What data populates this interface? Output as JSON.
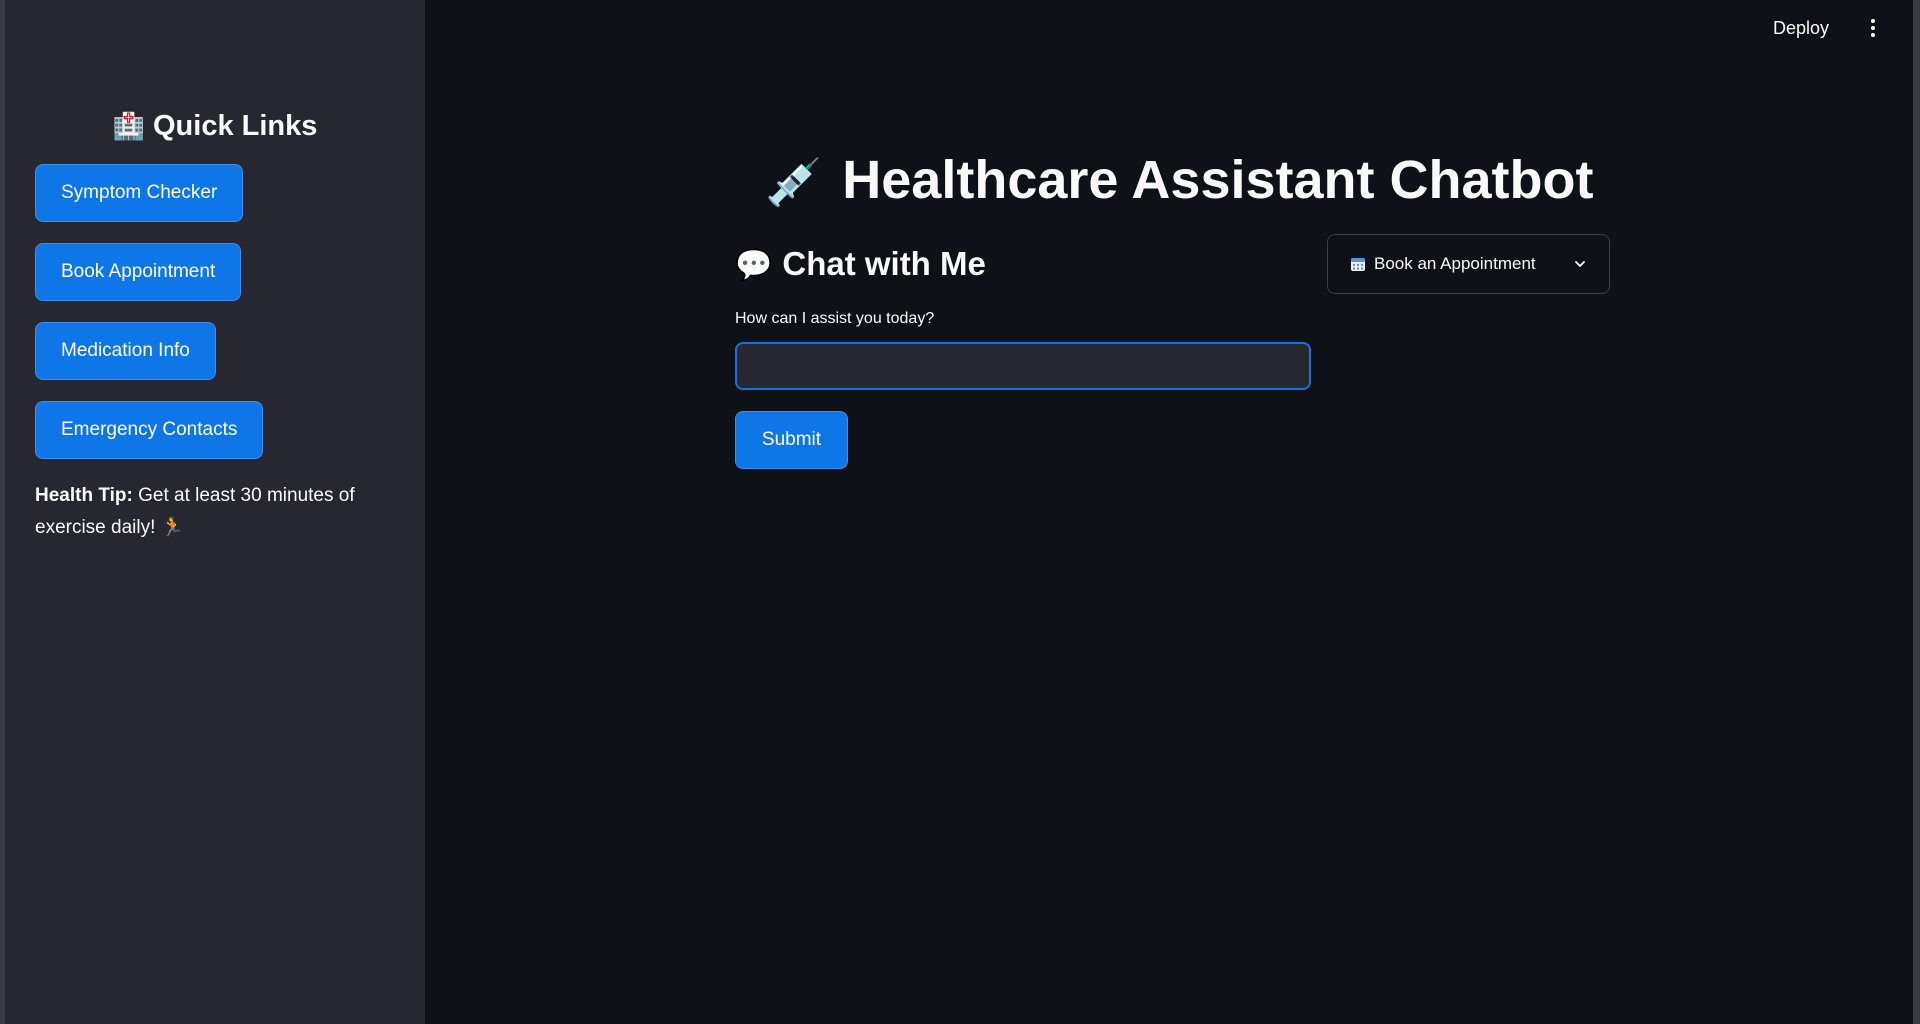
{
  "sidebar": {
    "title_emoji": "🏥",
    "title": "Quick Links",
    "buttons": [
      {
        "label": "Symptom Checker"
      },
      {
        "label": "Book Appointment"
      },
      {
        "label": "Medication Info"
      },
      {
        "label": "Emergency Contacts"
      }
    ],
    "health_tip": {
      "prefix": "Health Tip:",
      "text": " Get at least 30 minutes of exercise daily! 🏃"
    }
  },
  "header": {
    "deploy_label": "Deploy",
    "menu_icon": "kebab-menu-icon"
  },
  "main": {
    "title_emoji": "💉",
    "title": "Healthcare Assistant Chatbot",
    "chat_emoji": "💬",
    "chat_heading": "Chat with Me",
    "input_label": "How can I assist you today?",
    "input_value": "",
    "submit_label": "Submit",
    "expander_label": "Book an Appointment"
  },
  "colors": {
    "background": "#0e1117",
    "sidebar": "#262730",
    "primary_button": "#0f76e8"
  }
}
